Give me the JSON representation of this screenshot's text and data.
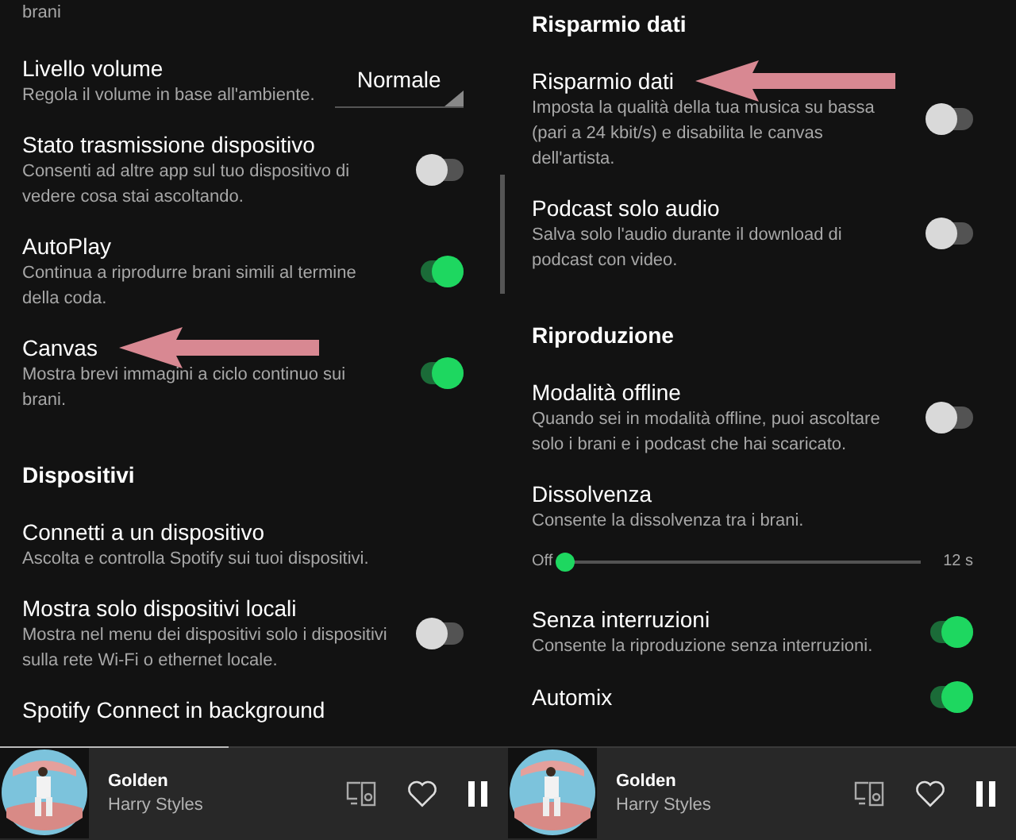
{
  "panels": [
    {
      "items": [
        {
          "kind": "cut",
          "description": "brani"
        },
        {
          "kind": "dropdown",
          "title": "Livello volume",
          "description": "Regola il volume in base all'ambiente.",
          "value": "Normale"
        },
        {
          "kind": "toggle",
          "title": "Stato trasmissione dispositivo",
          "description": "Consenti ad altre app sul tuo dispositivo di vedere cosa stai ascoltando.",
          "on": false
        },
        {
          "kind": "toggle",
          "title": "AutoPlay",
          "description": "Continua a riprodurre brani simili al termine della coda.",
          "on": true
        },
        {
          "kind": "toggle",
          "title": "Canvas",
          "description": "Mostra brevi immagini a ciclo continuo sui brani.",
          "on": true,
          "arrow": true
        },
        {
          "kind": "heading",
          "title": "Dispositivi"
        },
        {
          "kind": "link",
          "title": "Connetti a un dispositivo",
          "description": "Ascolta e controlla Spotify sui tuoi dispositivi."
        },
        {
          "kind": "toggle",
          "title": "Mostra solo dispositivi locali",
          "description": "Mostra nel menu dei dispositivi solo i dispositivi sulla rete Wi-Fi o ethernet locale.",
          "on": false
        },
        {
          "kind": "link",
          "title": "Spotify Connect in background"
        }
      ],
      "player": {
        "title": "Golden",
        "artist": "Harry Styles",
        "level": 0.45
      }
    },
    {
      "items": [
        {
          "kind": "heading",
          "title": "Risparmio dati"
        },
        {
          "kind": "toggle",
          "title": "Risparmio dati",
          "description": "Imposta la qualità della tua musica su bassa (pari a 24 kbit/s) e disabilita le canvas dell'artista.",
          "on": false,
          "arrow": true
        },
        {
          "kind": "toggle",
          "title": "Podcast solo audio",
          "description": "Salva solo l'audio durante il download di podcast con video.",
          "on": false
        },
        {
          "kind": "heading",
          "title": "Riproduzione"
        },
        {
          "kind": "toggle",
          "title": "Modalità offline",
          "description": "Quando sei in modalità offline, puoi ascoltare solo i brani e i podcast che hai scaricato.",
          "on": false
        },
        {
          "kind": "link",
          "title": "Dissolvenza",
          "description": "Consente la dissolvenza tra i brani."
        },
        {
          "kind": "slider",
          "min_label": "Off",
          "max_label": "12 s",
          "level": 0
        },
        {
          "kind": "toggle",
          "title": "Senza interruzioni",
          "description": "Consente la riproduzione senza interruzioni.",
          "on": true
        },
        {
          "kind": "toggle",
          "title": "Automix",
          "on": true
        }
      ],
      "player": {
        "title": "Golden",
        "artist": "Harry Styles"
      }
    }
  ]
}
